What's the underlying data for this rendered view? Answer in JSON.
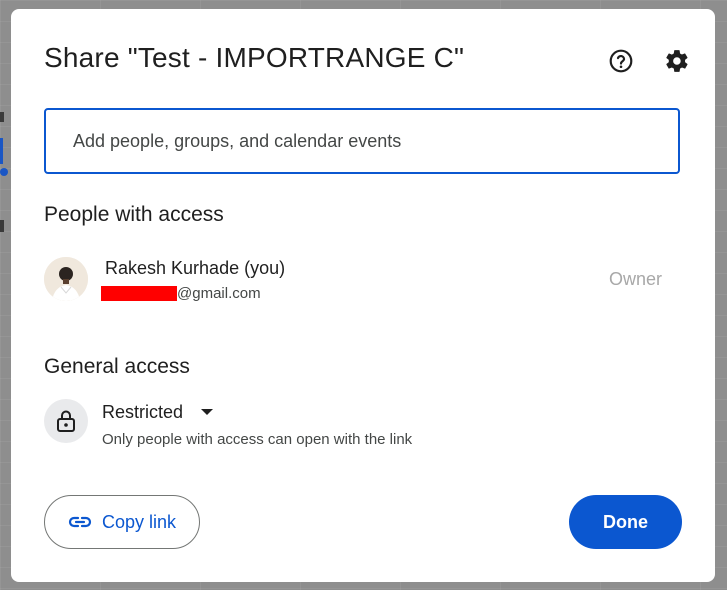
{
  "dialog": {
    "title": "Share \"Test - IMPORTRANGE C\"",
    "icons": {
      "help": "help-circle-icon",
      "settings": "gear-icon"
    }
  },
  "add_people": {
    "placeholder": "Add people, groups, and calendar events",
    "value": ""
  },
  "people_section": {
    "heading": "People with access",
    "people": [
      {
        "name": "Rakesh Kurhade (you)",
        "email_visible_suffix": "@gmail.com",
        "role": "Owner"
      }
    ]
  },
  "general_access": {
    "heading": "General access",
    "selected": "Restricted",
    "description": "Only people with access can open with the link",
    "icon": "lock-icon"
  },
  "actions": {
    "copy_link_label": "Copy link",
    "copy_link_icon": "link-icon",
    "done_label": "Done"
  },
  "colors": {
    "accent": "#0b57d0",
    "redaction": "#ff0000",
    "role_text": "#a8a8a8"
  }
}
